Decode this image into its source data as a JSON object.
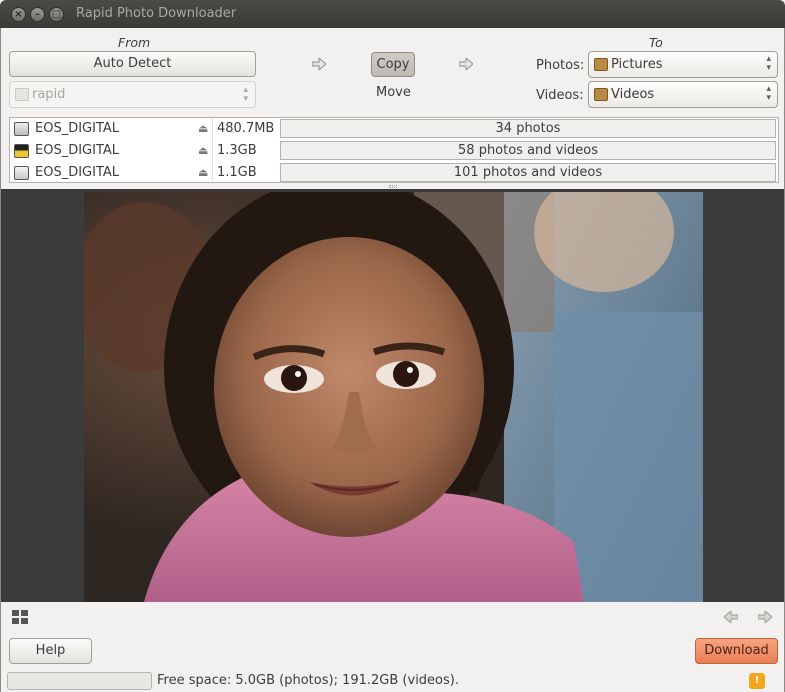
{
  "window": {
    "title": "Rapid Photo Downloader"
  },
  "source": {
    "heading": "From",
    "auto_detect_label": "Auto Detect",
    "folder_value": "rapid"
  },
  "mode": {
    "copy_label": "Copy",
    "move_label": "Move",
    "selected": "Copy"
  },
  "destination": {
    "heading": "To",
    "photos_label": "Photos:",
    "photos_folder": "Pictures",
    "videos_label": "Videos:",
    "videos_folder": "Videos"
  },
  "devices": [
    {
      "name": "EOS_DIGITAL",
      "size": "480.7MB",
      "status": "34 photos",
      "icon": "hard-drive-icon"
    },
    {
      "name": "EOS_DIGITAL",
      "size": "1.3GB",
      "status": "58 photos and videos",
      "icon": "memory-card-icon"
    },
    {
      "name": "EOS_DIGITAL",
      "size": "1.1GB",
      "status": "101 photos and videos",
      "icon": "usb-drive-icon"
    }
  ],
  "buttons": {
    "help_label": "Help",
    "download_label": "Download"
  },
  "status": {
    "free_space": "Free space: 5.0GB (photos); 191.2GB (videos)."
  },
  "colors": {
    "download_button": "#f08a5d",
    "title_bar": "#3c3b37"
  }
}
